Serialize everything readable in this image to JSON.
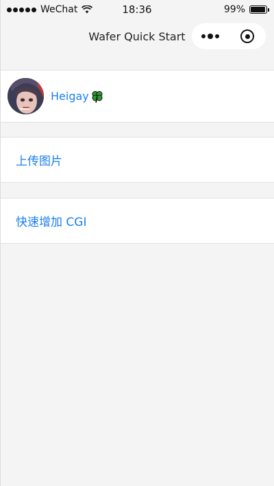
{
  "status_bar": {
    "carrier": "WeChat",
    "time": "18:36",
    "battery_percent_label": "99%",
    "battery_level": 0.99
  },
  "nav": {
    "title": "Wafer Quick Start"
  },
  "user": {
    "name": "Heigay"
  },
  "menu": {
    "upload_label": "上传图片",
    "cgi_label": "快速增加 CGI"
  },
  "colors": {
    "link": "#1a7ff0",
    "page_bg": "#f4f4f4"
  }
}
